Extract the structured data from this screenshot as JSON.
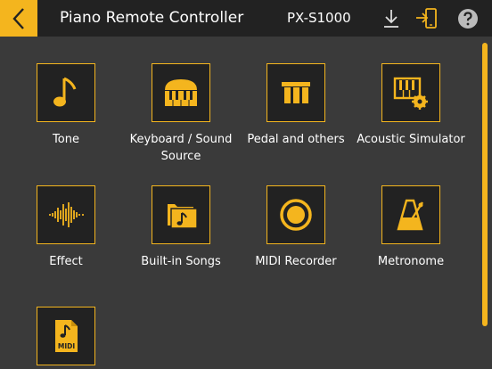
{
  "header": {
    "title": "Piano Remote Controller",
    "model": "PX-S1000"
  },
  "colors": {
    "accent": "#f4b51e",
    "background": "#3a3a3a",
    "bar": "#222222"
  },
  "icons": {
    "back": "chevron-left-icon",
    "download": "download-icon",
    "connect": "connect-device-icon",
    "help": "help-icon"
  },
  "menu": [
    {
      "label": "Tone",
      "icon": "music-note-icon"
    },
    {
      "label": "Keyboard / Sound Source",
      "icon": "piano-keyboard-icon"
    },
    {
      "label": "Pedal and others",
      "icon": "pedal-icon"
    },
    {
      "label": "Acoustic Simulator",
      "icon": "keyboard-gear-icon"
    },
    {
      "label": "Effect",
      "icon": "waveform-icon"
    },
    {
      "label": "Built-in Songs",
      "icon": "song-folder-icon"
    },
    {
      "label": "MIDI Recorder",
      "icon": "record-icon"
    },
    {
      "label": "Metronome",
      "icon": "metronome-icon"
    },
    {
      "label": "",
      "icon": "midi-file-icon",
      "badge": "MIDI"
    }
  ]
}
